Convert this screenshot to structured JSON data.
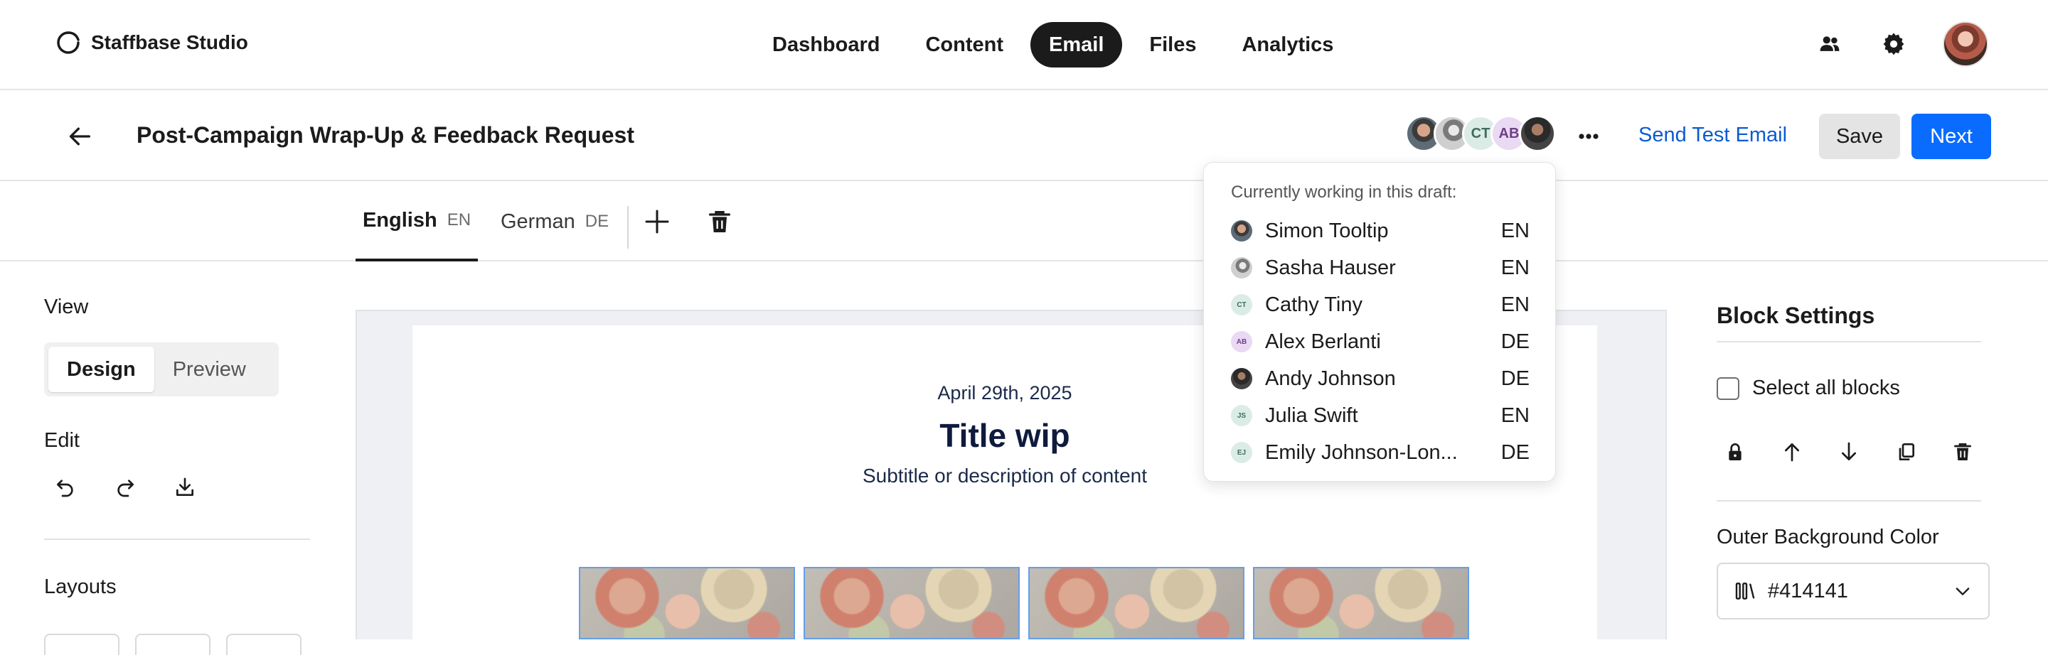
{
  "topnav": {
    "brand": "Staffbase Studio",
    "tabs": [
      {
        "label": "Dashboard"
      },
      {
        "label": "Content"
      },
      {
        "label": "Email",
        "active": true
      },
      {
        "label": "Files"
      },
      {
        "label": "Analytics"
      }
    ],
    "icons": [
      "people-icon",
      "gear-icon",
      "user-avatar"
    ]
  },
  "subheader": {
    "title": "Post-Campaign Wrap-Up & Feedback Request",
    "collaborator_avatars": [
      "photo",
      "photo",
      "CT",
      "AB",
      "photo"
    ],
    "ct_initials": "CT",
    "ab_initials": "AB",
    "send_test_label": "Send Test Email",
    "save_label": "Save",
    "next_label": "Next"
  },
  "languages": {
    "tabs": [
      {
        "name": "English",
        "code": "EN",
        "active": true
      },
      {
        "name": "German",
        "code": "DE",
        "active": false
      }
    ]
  },
  "left_panel": {
    "view_label": "View",
    "view_options": [
      "Design",
      "Preview"
    ],
    "view_selected": "Design",
    "edit_label": "Edit",
    "layouts_label": "Layouts"
  },
  "email": {
    "date": "April 29th, 2025",
    "title": "Title wip",
    "subtitle": "Subtitle or description of content",
    "image_count": 4
  },
  "popover": {
    "heading": "Currently working in this draft:",
    "collaborators": [
      {
        "name": "Simon Tooltip",
        "lang": "EN",
        "avatar": "photo"
      },
      {
        "name": "Sasha Hauser",
        "lang": "EN",
        "avatar": "photo"
      },
      {
        "name": "Cathy Tiny",
        "lang": "EN",
        "avatar": "CT"
      },
      {
        "name": "Alex Berlanti",
        "lang": "DE",
        "avatar": "AB"
      },
      {
        "name": "Andy Johnson",
        "lang": "DE",
        "avatar": "photo"
      },
      {
        "name": "Julia Swift",
        "lang": "EN",
        "avatar": "JS"
      },
      {
        "name": "Emily Johnson-Lon...",
        "lang": "DE",
        "avatar": "EJ"
      }
    ]
  },
  "right_panel": {
    "title": "Block Settings",
    "select_all_label": "Select all blocks",
    "outer_bg_label": "Outer Background Color",
    "outer_bg_value": "#414141"
  },
  "colors": {
    "accent": "#0a6cff",
    "link": "#0a5bd3",
    "active_tab_bg": "#1b1b1b",
    "email_title": "#0f1b3d"
  }
}
